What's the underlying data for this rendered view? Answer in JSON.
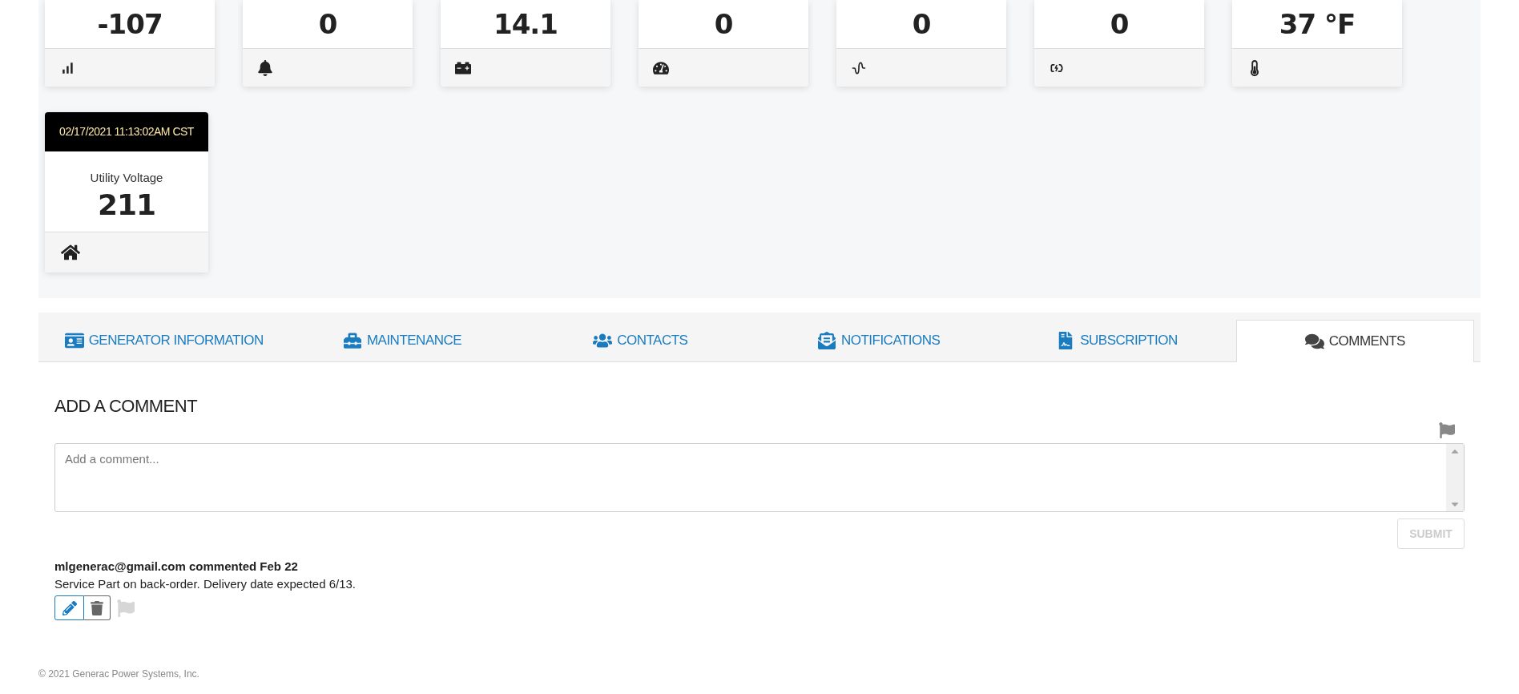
{
  "metric_cards": [
    {
      "value": "-107",
      "kind": "signal"
    },
    {
      "value": "0",
      "kind": "alarm"
    },
    {
      "value": "14.1",
      "kind": "battery"
    },
    {
      "value": "0",
      "kind": "speed"
    },
    {
      "value": "0",
      "kind": "frequency"
    },
    {
      "value": "0",
      "kind": "charging"
    },
    {
      "value": "37 °F",
      "kind": "temperature"
    }
  ],
  "utility_card": {
    "timestamp": "02/17/2021 11:13:02AM CST",
    "label": "Utility Voltage",
    "value": "211"
  },
  "tabs": [
    {
      "label": "GENERATOR INFORMATION",
      "kind": "info",
      "selected": false
    },
    {
      "label": "MAINTENANCE",
      "kind": "maintenance",
      "selected": false
    },
    {
      "label": "CONTACTS",
      "kind": "contacts",
      "selected": false
    },
    {
      "label": "NOTIFICATIONS",
      "kind": "notifications",
      "selected": false
    },
    {
      "label": "SUBSCRIPTION",
      "kind": "subscription",
      "selected": false
    },
    {
      "label": "COMMENTS",
      "kind": "comments",
      "selected": true
    }
  ],
  "comments_section": {
    "title": "ADD A COMMENT",
    "placeholder": "Add a comment...",
    "submit": {
      "label": "SUBMIT",
      "disabled": true
    },
    "comments": [
      {
        "author_line": "mlgenerac@gmail.com commented Feb 22",
        "text": "Service Part on back-order. Delivery date expected 6/13.",
        "flagged": false
      }
    ]
  },
  "footer": "© 2021 Generac Power Systems, Inc."
}
